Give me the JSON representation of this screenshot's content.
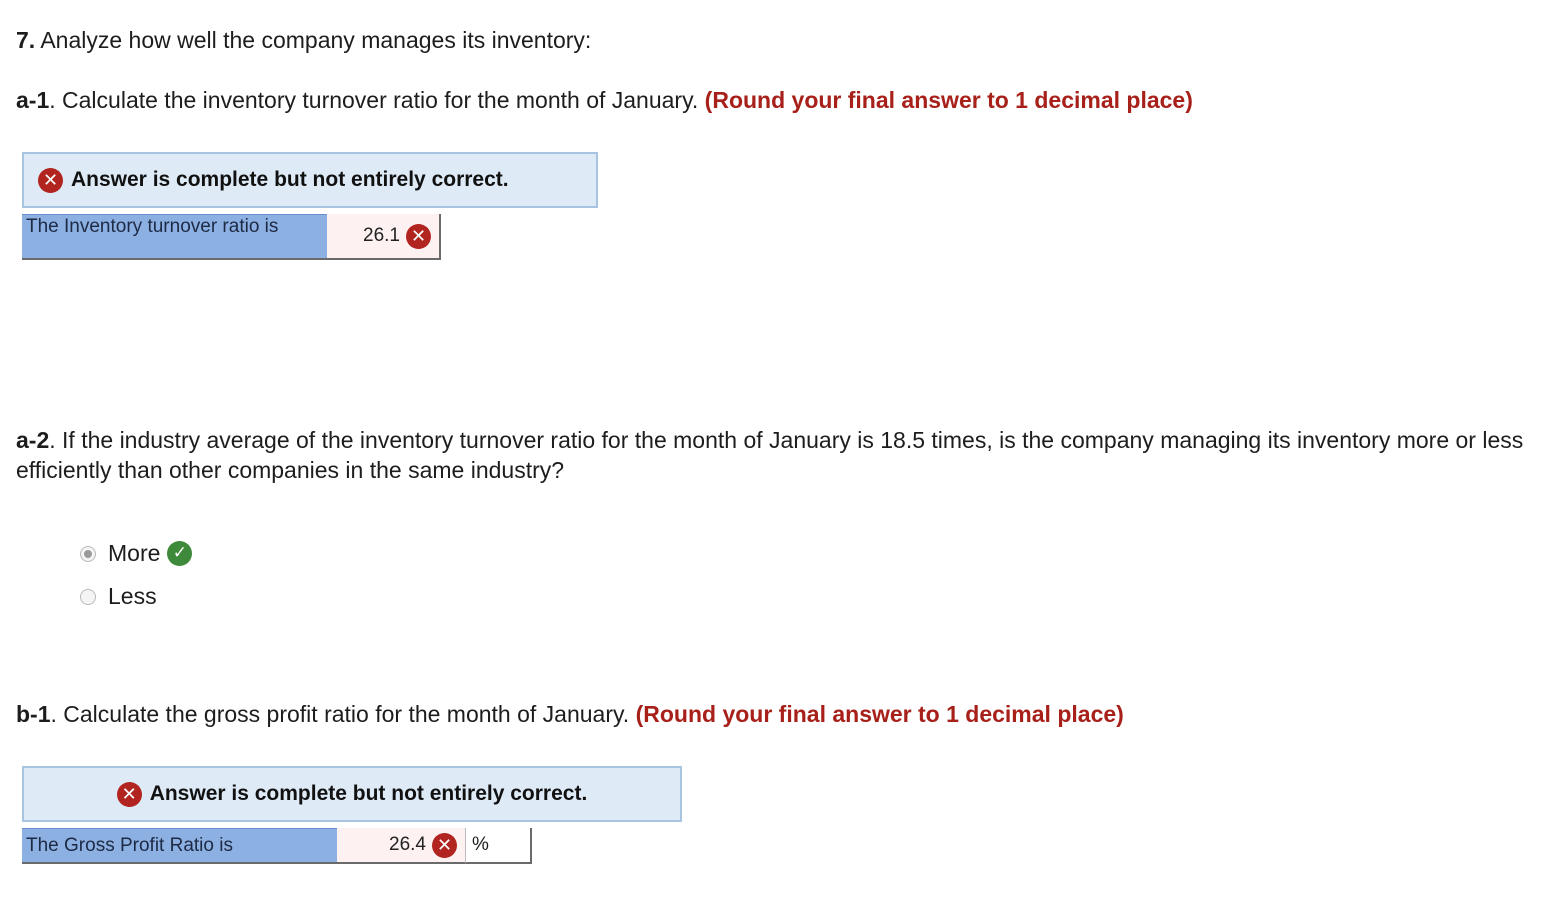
{
  "q7": {
    "number": "7.",
    "text": "Analyze how well the company manages its inventory:"
  },
  "a1": {
    "label": "a-1",
    "text": ". Calculate the inventory turnover ratio for the month of January.",
    "instruction": "(Round your final answer to 1 decimal place)",
    "banner": "Answer is complete but not entirely correct.",
    "row_label": "The Inventory turnover ratio is",
    "value": "26.1"
  },
  "a2": {
    "label": "a-2",
    "text": ". If the industry average of the inventory turnover ratio for the month of January is 18.5 times, is the company managing its inventory more or less efficiently than other companies in the same industry?",
    "options": [
      {
        "label": "More",
        "selected": true,
        "status": "correct"
      },
      {
        "label": "Less",
        "selected": false
      }
    ]
  },
  "b1": {
    "label": "b-1",
    "text": ". Calculate the gross profit ratio for the month of January.",
    "instruction": "(Round your final answer to 1 decimal place)",
    "banner": "Answer is complete but not entirely correct.",
    "row_label": "The Gross Profit Ratio is",
    "value": "26.4",
    "unit": "%"
  },
  "icons": {
    "incorrect": "x-circle-icon",
    "correct": "check-circle-icon"
  },
  "colors": {
    "instruction_red": "#a8201a",
    "banner_bg": "#deebf7",
    "label_cell_bg": "#8db0e3",
    "incorrect_red": "#b2241f",
    "correct_green": "#3f8a3a"
  }
}
